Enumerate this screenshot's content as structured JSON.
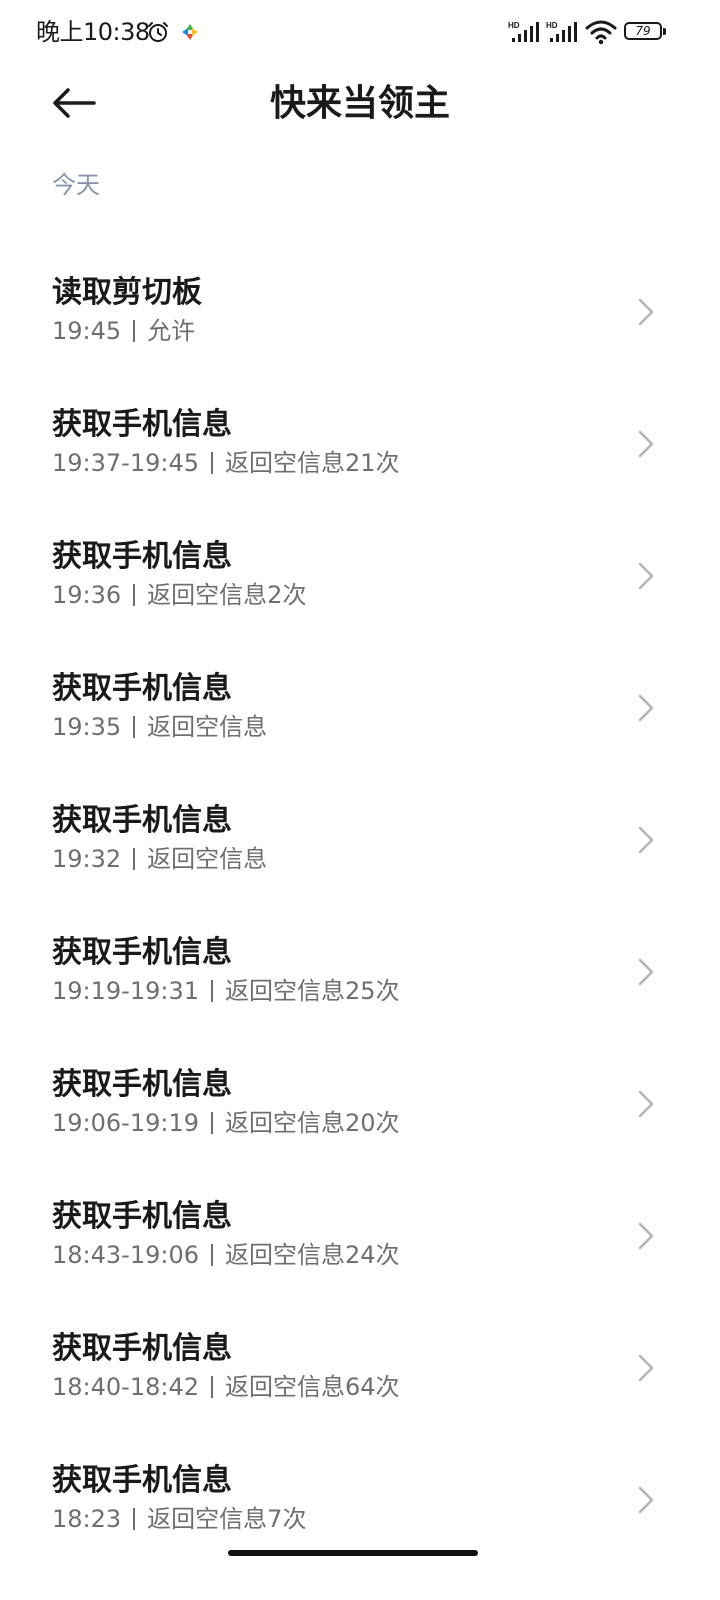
{
  "status_bar": {
    "time": "晚上10:38",
    "battery_level": "79",
    "signal_1_label": "HD",
    "signal_2_label": "HD"
  },
  "header": {
    "title": "快来当领主",
    "back_icon": "arrow-left-icon"
  },
  "section": {
    "label": "今天"
  },
  "records": [
    {
      "title": "读取剪切板",
      "time": "19:45",
      "result": "允许"
    },
    {
      "title": "获取手机信息",
      "time": "19:37-19:45",
      "result": "返回空信息21次"
    },
    {
      "title": "获取手机信息",
      "time": "19:36",
      "result": "返回空信息2次"
    },
    {
      "title": "获取手机信息",
      "time": "19:35",
      "result": "返回空信息"
    },
    {
      "title": "获取手机信息",
      "time": "19:32",
      "result": "返回空信息"
    },
    {
      "title": "获取手机信息",
      "time": "19:19-19:31",
      "result": "返回空信息25次"
    },
    {
      "title": "获取手机信息",
      "time": "19:06-19:19",
      "result": "返回空信息20次"
    },
    {
      "title": "获取手机信息",
      "time": "18:43-19:06",
      "result": "返回空信息24次"
    },
    {
      "title": "获取手机信息",
      "time": "18:40-18:42",
      "result": "返回空信息64次"
    },
    {
      "title": "获取手机信息",
      "time": "18:23",
      "result": "返回空信息7次"
    }
  ],
  "colors": {
    "section_label": "#8a96ab",
    "meta_text": "#6f6f6f",
    "title_text": "#1a1a1a"
  }
}
